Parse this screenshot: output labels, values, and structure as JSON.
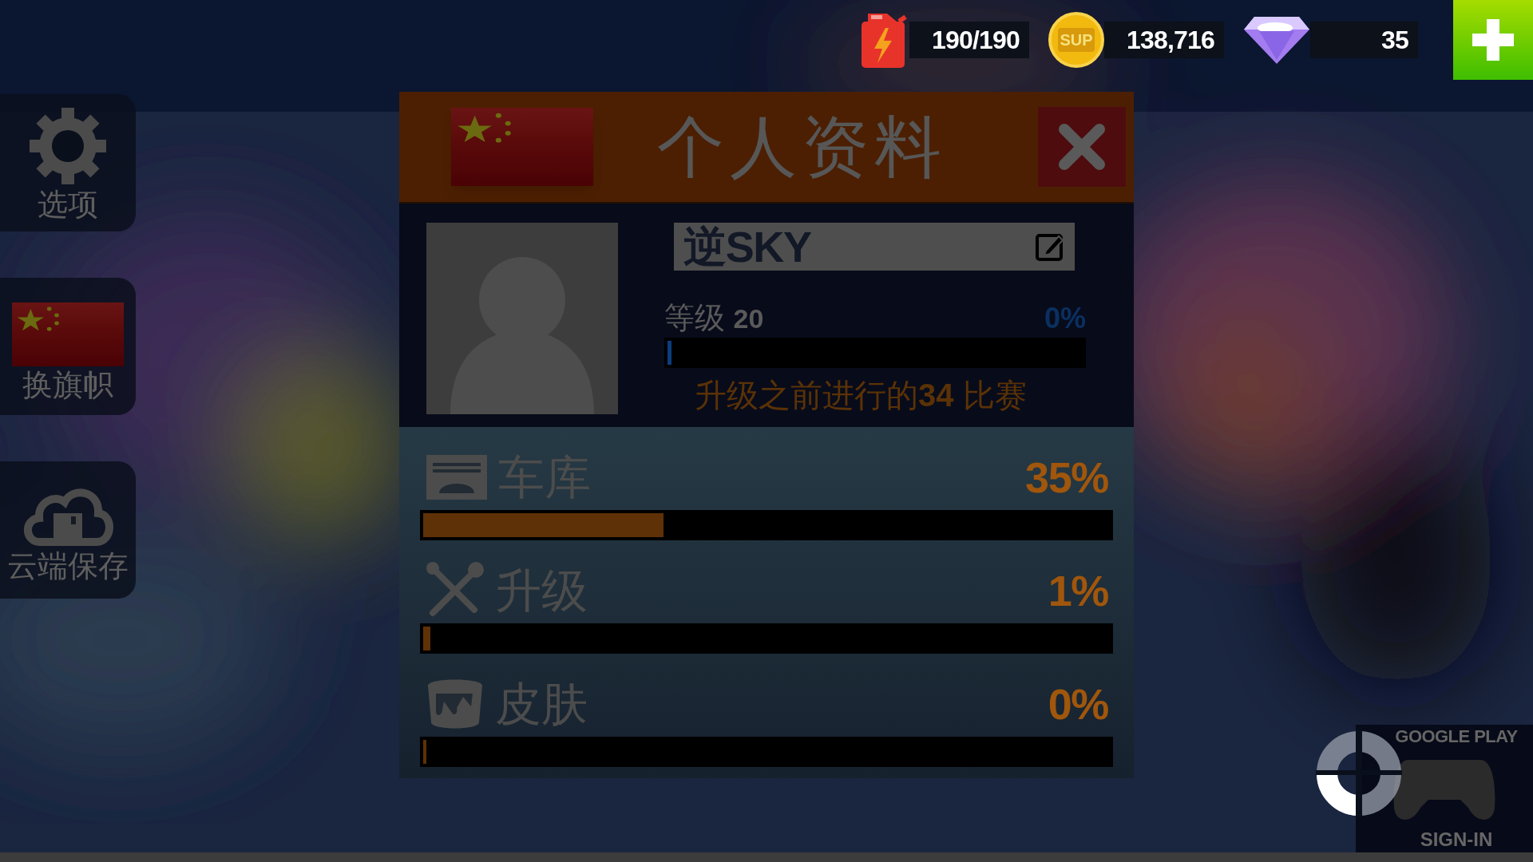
{
  "resources": [
    {
      "kind": "fuel",
      "value": "190/190"
    },
    {
      "kind": "coin",
      "badge": "SUP",
      "value": "138,716"
    },
    {
      "kind": "gem",
      "value": "35"
    }
  ],
  "sidebar": [
    {
      "kind": "settings",
      "label": "选项"
    },
    {
      "kind": "flag",
      "label": "换旗帜"
    },
    {
      "kind": "cloud",
      "label": "云端保存"
    }
  ],
  "profile": {
    "title": "个人资料",
    "name": "逆SKY",
    "rank_label": "等级",
    "rank": "20",
    "rank_reading": "0%",
    "level": 0.005,
    "note": "升级之前进行的**34** 比赛"
  },
  "stats": [
    {
      "kind": "garage",
      "label": "车库",
      "reading": "35%",
      "level": 0.35
    },
    {
      "kind": "upgrade",
      "label": "升级",
      "reading": "1%",
      "level": 0.01
    },
    {
      "kind": "skin",
      "label": "皮肤",
      "reading": "0%",
      "level": 0
    }
  ],
  "google_play": {
    "title": "GOOGLE PLAY",
    "action": "SIGN-IN"
  }
}
